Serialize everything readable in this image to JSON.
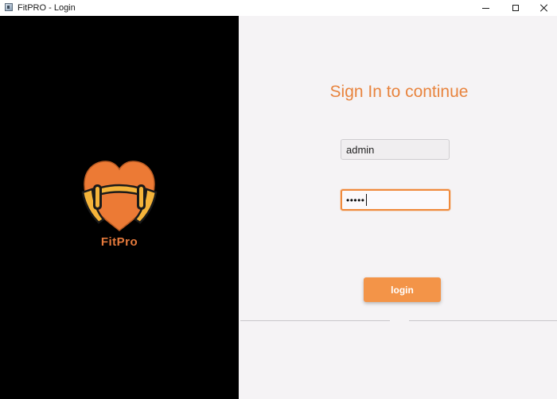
{
  "window": {
    "title": "FitPRO - Login",
    "icons": {
      "app": "app-window-icon",
      "minimize": "minimize-icon",
      "maximize": "maximize-icon",
      "close": "close-icon"
    }
  },
  "brand": {
    "name": "FitPro",
    "logo_icon": "heart-dumbbell-logo",
    "background_color": "#000000",
    "accent_color": "#e67a3c"
  },
  "form": {
    "heading": "Sign In to continue",
    "username": {
      "value": "admin"
    },
    "password": {
      "masked_value": "•••••"
    },
    "login_label": "login",
    "accent_color": "#f39448",
    "background_color": "#f5f3f5"
  }
}
